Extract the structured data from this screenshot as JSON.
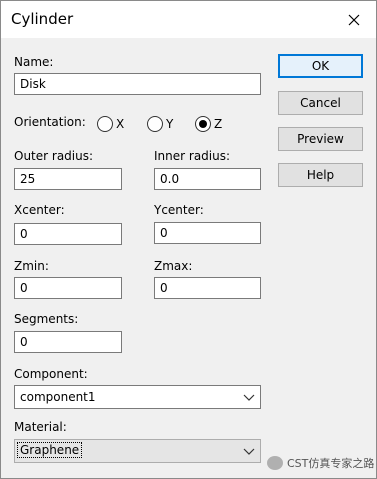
{
  "window": {
    "title": "Cylinder"
  },
  "form": {
    "name_label": "Name:",
    "name_value": "Disk",
    "orientation_label": "Orientation:",
    "orientation_options": [
      "X",
      "Y",
      "Z"
    ],
    "orientation_selected": "Z",
    "outer_radius_label": "Outer radius:",
    "outer_radius_value": "25",
    "inner_radius_label": "Inner radius:",
    "inner_radius_value": "0.0",
    "xcenter_label": "Xcenter:",
    "xcenter_value": "0",
    "ycenter_label": "Ycenter:",
    "ycenter_value": "0",
    "zmin_label": "Zmin:",
    "zmin_value": "0",
    "zmax_label": "Zmax:",
    "zmax_value": "0",
    "segments_label": "Segments:",
    "segments_value": "0",
    "component_label": "Component:",
    "component_value": "component1",
    "material_label": "Material:",
    "material_value": "Graphene"
  },
  "buttons": {
    "ok": "OK",
    "cancel": "Cancel",
    "preview": "Preview",
    "help": "Help"
  },
  "watermark": {
    "text": "CST仿真专家之路"
  }
}
